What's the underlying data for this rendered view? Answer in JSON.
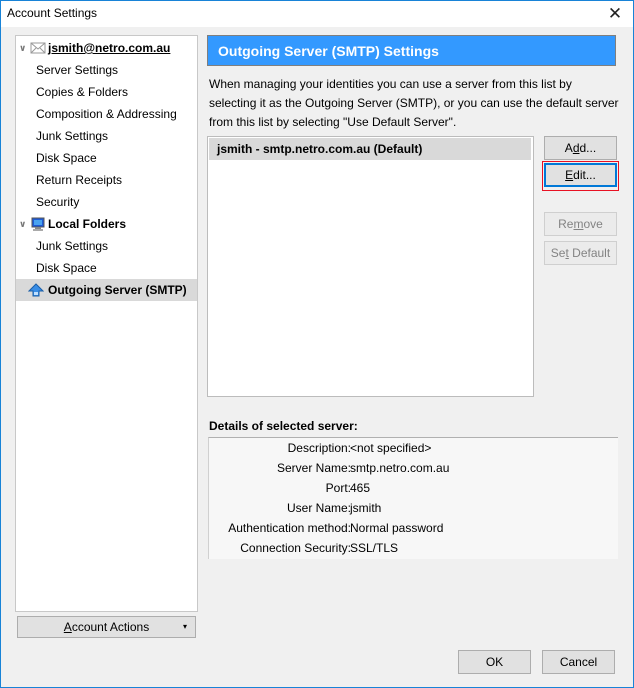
{
  "window": {
    "title": "Account Settings",
    "close_label": "✕"
  },
  "tree": {
    "account": {
      "label": "jsmith@netro.com.au",
      "icon": "envelope-icon"
    },
    "account_children": [
      "Server Settings",
      "Copies & Folders",
      "Composition & Addressing",
      "Junk Settings",
      "Disk Space",
      "Return Receipts",
      "Security"
    ],
    "local": {
      "label": "Local Folders",
      "icon": "computer-icon"
    },
    "local_children": [
      "Junk Settings",
      "Disk Space"
    ],
    "outgoing": {
      "label": "Outgoing Server (SMTP)",
      "icon": "outgoing-server-icon",
      "selected": true
    }
  },
  "account_actions": {
    "label_pre": "",
    "label_mn": "A",
    "label_post": "ccount Actions",
    "caret": "▾"
  },
  "panel": {
    "title": "Outgoing Server (SMTP) Settings",
    "description": "When managing your identities you can use a server from this list by selecting it as the Outgoing Server (SMTP), or you can use the default server from this list by selecting \"Use Default Server\".",
    "servers": [
      "jsmith - smtp.netro.com.au (Default)"
    ],
    "buttons": {
      "add": {
        "pre": "A",
        "mn": "d",
        "post": "d..."
      },
      "edit": {
        "pre": "",
        "mn": "E",
        "post": "dit..."
      },
      "remove": {
        "pre": "Re",
        "mn": "m",
        "post": "ove"
      },
      "set_default": {
        "pre": "Se",
        "mn": "t",
        "post": " Default"
      }
    }
  },
  "details": {
    "title": "Details of selected server:",
    "rows": [
      {
        "label": "Description:",
        "value": "<not specified>"
      },
      {
        "label": "Server Name:",
        "value": "smtp.netro.com.au"
      },
      {
        "label": "Port:",
        "value": "465"
      },
      {
        "label": "User Name:",
        "value": "jsmith"
      },
      {
        "label": "Authentication method:",
        "value": "Normal password"
      },
      {
        "label": "Connection Security:",
        "value": "SSL/TLS"
      }
    ]
  },
  "footer": {
    "ok": "OK",
    "cancel": "Cancel"
  }
}
